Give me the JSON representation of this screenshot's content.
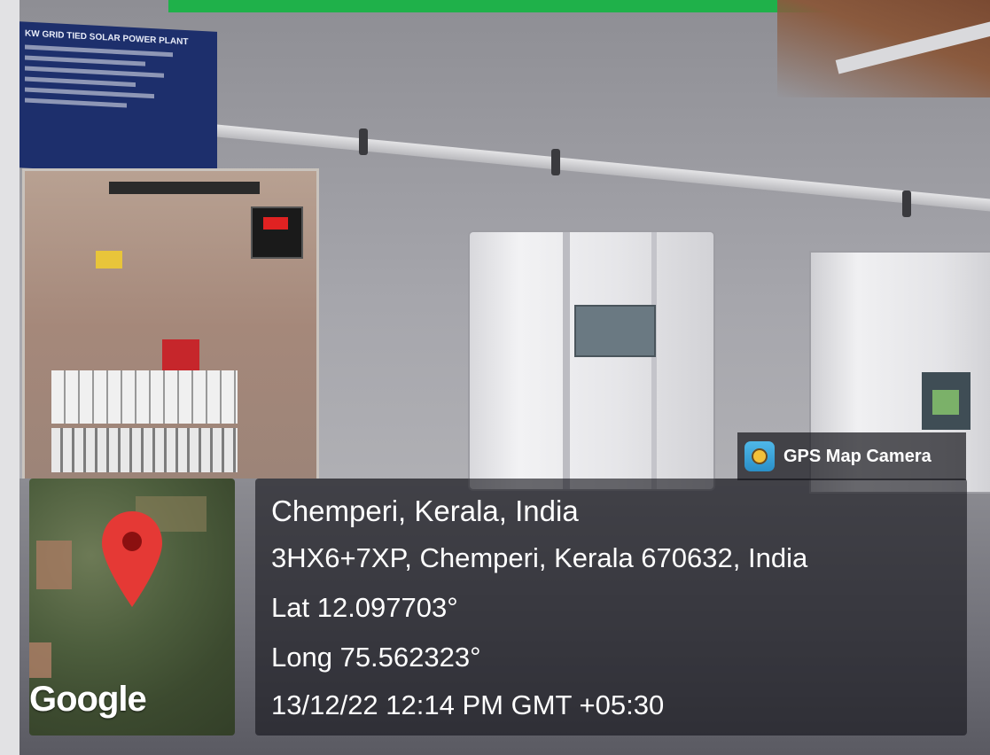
{
  "badge": {
    "icon": "gps-map-camera-icon",
    "label": "GPS Map Camera"
  },
  "map": {
    "provider": "Google",
    "pin_icon": "location-pin-icon",
    "pin_color": "#e53935"
  },
  "info": {
    "place": "Chemperi, Kerala, India",
    "address": "3HX6+7XP, Chemperi, Kerala 670632, India",
    "latitude": "Lat 12.097703°",
    "longitude": "Long 75.562323°",
    "datetime": "13/12/22 12:14 PM GMT +05:30"
  },
  "sign": {
    "title": "KW GRID TIED SOLAR POWER PLANT"
  },
  "colors": {
    "top_bar": "#1fb14a",
    "overlay": "#14141a"
  }
}
